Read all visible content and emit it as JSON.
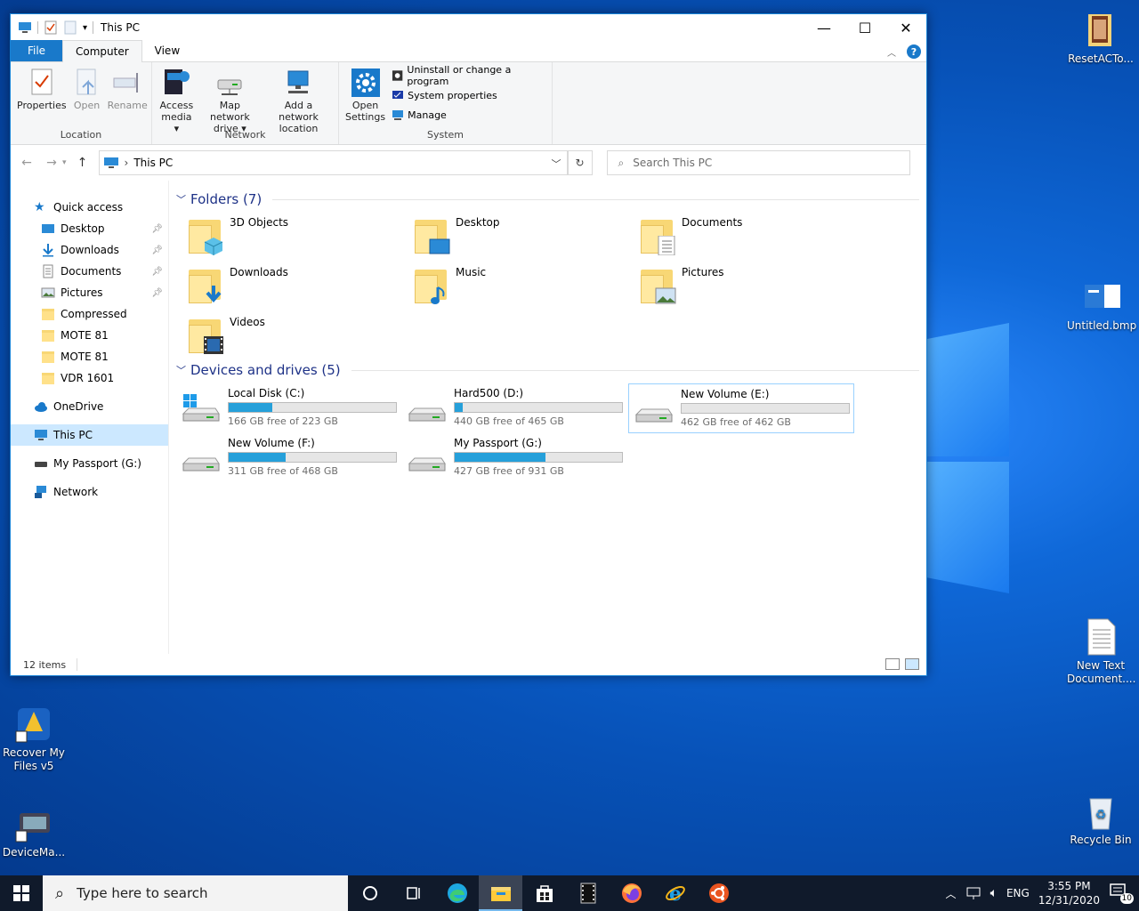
{
  "window": {
    "title": "This PC",
    "ribbon_tabs": [
      "File",
      "Computer",
      "View"
    ],
    "groups": {
      "location": {
        "label": "Location",
        "buttons": [
          {
            "label": "Properties",
            "icon": "properties-icon",
            "enabled": true
          },
          {
            "label": "Open",
            "icon": "open-icon",
            "enabled": false
          },
          {
            "label": "Rename",
            "icon": "rename-icon",
            "enabled": false
          }
        ]
      },
      "network": {
        "label": "Network",
        "buttons": [
          {
            "label": "Access\nmedia ▾",
            "line1": "Access",
            "line2": "media",
            "icon": "access-media-icon"
          },
          {
            "line1": "Map network",
            "line2": "drive",
            "icon": "map-network-drive-icon"
          },
          {
            "line1": "Add a network",
            "line2": "location",
            "icon": "add-network-location-icon"
          }
        ]
      },
      "system": {
        "label": "System",
        "open_settings_line1": "Open",
        "open_settings_line2": "Settings",
        "items": [
          "Uninstall or change a program",
          "System properties",
          "Manage"
        ]
      }
    },
    "address": {
      "crumb": "This PC"
    },
    "search": {
      "placeholder": "Search This PC"
    },
    "nav_pane": {
      "quick_access": "Quick access",
      "quick_items": [
        {
          "label": "Desktop",
          "pinned": true
        },
        {
          "label": "Downloads",
          "pinned": true
        },
        {
          "label": "Documents",
          "pinned": true
        },
        {
          "label": "Pictures",
          "pinned": true
        },
        {
          "label": "Compressed",
          "pinned": false
        },
        {
          "label": "MOTE 81",
          "pinned": false
        },
        {
          "label": "MOTE 81",
          "pinned": false
        },
        {
          "label": "VDR 1601",
          "pinned": false
        }
      ],
      "onedrive": "OneDrive",
      "this_pc": "This PC",
      "my_passport": "My Passport (G:)",
      "network": "Network"
    },
    "folders_header": "Folders (7)",
    "folders": [
      "3D Objects",
      "Desktop",
      "Documents",
      "Downloads",
      "Music",
      "Pictures",
      "Videos"
    ],
    "drives_header": "Devices and drives (5)",
    "drives": [
      {
        "name": "Local Disk (C:)",
        "free": "166 GB free of 223 GB",
        "used_fraction": 0.26
      },
      {
        "name": "Hard500 (D:)",
        "free": "440 GB free of 465 GB",
        "used_fraction": 0.05
      },
      {
        "name": "New Volume (E:)",
        "free": "462 GB free of 462 GB",
        "used_fraction": 0.0
      },
      {
        "name": "New Volume (F:)",
        "free": "311 GB free of 468 GB",
        "used_fraction": 0.34
      },
      {
        "name": "My Passport (G:)",
        "free": "427 GB free of 931 GB",
        "used_fraction": 0.54
      }
    ],
    "status": "12 items"
  },
  "desktop_icons": [
    {
      "label": "ResetACTo...",
      "icon": "folder-image-icon"
    },
    {
      "label": "Untitled.bmp",
      "icon": "bitmap-icon"
    },
    {
      "label": "New Text\nDocument....",
      "line1": "New Text",
      "line2": "Document....",
      "icon": "text-document-icon"
    },
    {
      "label": "Recycle Bin",
      "icon": "recycle-bin-icon"
    },
    {
      "line1": "Recover My",
      "line2": "Files v5",
      "icon": "recover-my-files-icon"
    },
    {
      "label": "DeviceMa...",
      "icon": "device-manager-icon"
    }
  ],
  "taskbar": {
    "search_placeholder": "Type here to search",
    "apps": [
      "cortana-icon",
      "task-view-icon",
      "edge-icon",
      "file-explorer-icon",
      "store-icon",
      "film-app-icon",
      "firefox-icon",
      "internet-explorer-icon",
      "ubuntu-icon"
    ],
    "language": "ENG",
    "time": "3:55 PM",
    "date": "12/31/2020",
    "notification_count": "10"
  },
  "colors": {
    "accent": "#1979ca",
    "drive_bar": "#26a0da",
    "section_header": "#1e3287",
    "selection": "#cce8ff"
  }
}
